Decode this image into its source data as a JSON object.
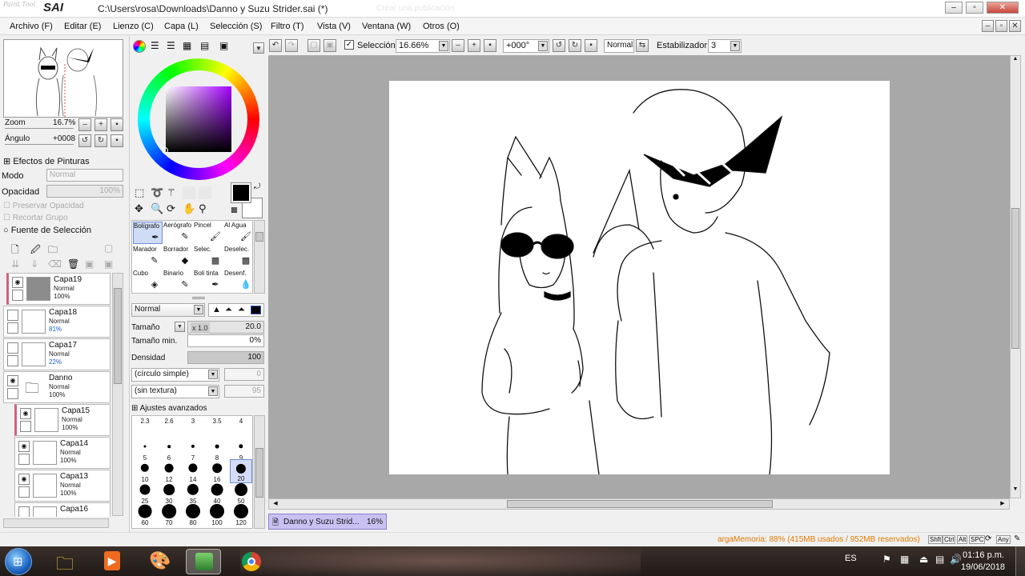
{
  "window": {
    "app_logo_small": "Paint Tool",
    "app_logo_big": "SAI",
    "title": "C:\\Users\\rosa\\Downloads\\Danno y Suzu Strider.sai (*)",
    "bg_title_ghost": "Crear una publicación"
  },
  "menu": [
    "Archivo (F)",
    "Editar (E)",
    "Lienzo (C)",
    "Capa (L)",
    "Selección (S)",
    "Filtro (T)",
    "Vista (V)",
    "Ventana (W)",
    "Otros (O)"
  ],
  "navigator": {
    "zoom_label": "Zoom",
    "zoom_value": "16.7%",
    "angle_label": "Ángulo",
    "angle_value": "+0008"
  },
  "layer_props": {
    "effects_label": "Efectos de Pinturas",
    "mode_label": "Modo",
    "mode_value": "Normal",
    "opacity_label": "Opacidad",
    "opacity_value": "100%",
    "preserve_opacity": "Preservar Opacidad",
    "clip_group": "Recortar Grupo",
    "selection_source": "Fuente de Selección"
  },
  "layers": [
    {
      "name": "Capa19",
      "mode": "Normal",
      "opacity": "100%",
      "opacity_color": "#111111"
    },
    {
      "name": "Capa18",
      "mode": "Normal",
      "opacity": "81%",
      "opacity_color": "#1a5fc8"
    },
    {
      "name": "Capa17",
      "mode": "Normal",
      "opacity": "22%",
      "opacity_color": "#1a5fc8"
    },
    {
      "name": "Danno",
      "mode": "Normal",
      "opacity": "100%",
      "opacity_color": "#111111"
    },
    {
      "name": "Capa15",
      "mode": "Normal",
      "opacity": "100%",
      "opacity_color": "#111111"
    },
    {
      "name": "Capa14",
      "mode": "Normal",
      "opacity": "100%",
      "opacity_color": "#111111"
    },
    {
      "name": "Capa13",
      "mode": "Normal",
      "opacity": "100%",
      "opacity_color": "#111111"
    },
    {
      "name": "Capa16",
      "mode": "",
      "opacity": "",
      "opacity_color": "#111111"
    }
  ],
  "tools": [
    {
      "label": "Bolígrafo",
      "icon": "pen-icon"
    },
    {
      "label": "Aerógrafo",
      "icon": "airbrush-icon"
    },
    {
      "label": "Pincel",
      "icon": "brush-icon"
    },
    {
      "label": "Al Agua",
      "icon": "water-icon"
    },
    {
      "label": "Marador",
      "icon": "marker-icon"
    },
    {
      "label": "Borrador",
      "icon": "eraser-icon"
    },
    {
      "label": "Selec.",
      "icon": "select-pen-icon"
    },
    {
      "label": "Deselec.",
      "icon": "deselect-pen-icon"
    },
    {
      "label": "Cubo",
      "icon": "bucket-icon"
    },
    {
      "label": "Binario",
      "icon": "binary-pen-icon"
    },
    {
      "label": "Boli tinta",
      "icon": "ink-pen-icon"
    },
    {
      "label": "Desenf.",
      "icon": "blur-icon"
    }
  ],
  "brush": {
    "blend_mode": "Normal",
    "size_label": "Tamaño",
    "size_mult": "x 1.0",
    "size_value": "20.0",
    "min_size_label": "Tamaño min.",
    "min_size_value": "0%",
    "density_label": "Densidad",
    "density_value": "100",
    "shape": "(círculo simple)",
    "shape_value": "0",
    "texture": "(sin textura)",
    "texture_value": "95",
    "advanced_label": "Ajustes avanzados"
  },
  "brush_sizes": [
    "2.3",
    "2.6",
    "3",
    "3.5",
    "4",
    "5",
    "6",
    "7",
    "8",
    "9",
    "10",
    "12",
    "14",
    "16",
    "20",
    "25",
    "30",
    "35",
    "40",
    "50",
    "60",
    "70",
    "80",
    "100",
    "120"
  ],
  "toolbar": {
    "selection_label": "Selección",
    "zoom_value": "16.66%",
    "rotation_value": "+000°",
    "mode_value": "Normal",
    "stabilizer_label": "Estabilizador",
    "stabilizer_value": "3"
  },
  "doc_tab": {
    "name": "Danno y Suzu Strid...",
    "zoom": "16%"
  },
  "status": {
    "memory": "argaMemoria: 88% (415MB usados / 952MB reservados)",
    "keys": [
      "Shft",
      "Ctrl",
      "Alt",
      "SPC",
      "Any"
    ]
  },
  "taskbar": {
    "lang": "ES",
    "time": "01:16 p.m.",
    "date": "19/06/2018"
  },
  "colors": {
    "primary": "#000000",
    "secondary": "#ffffff",
    "accent_layer": "#d4607e",
    "memory_text": "#e07b00"
  }
}
